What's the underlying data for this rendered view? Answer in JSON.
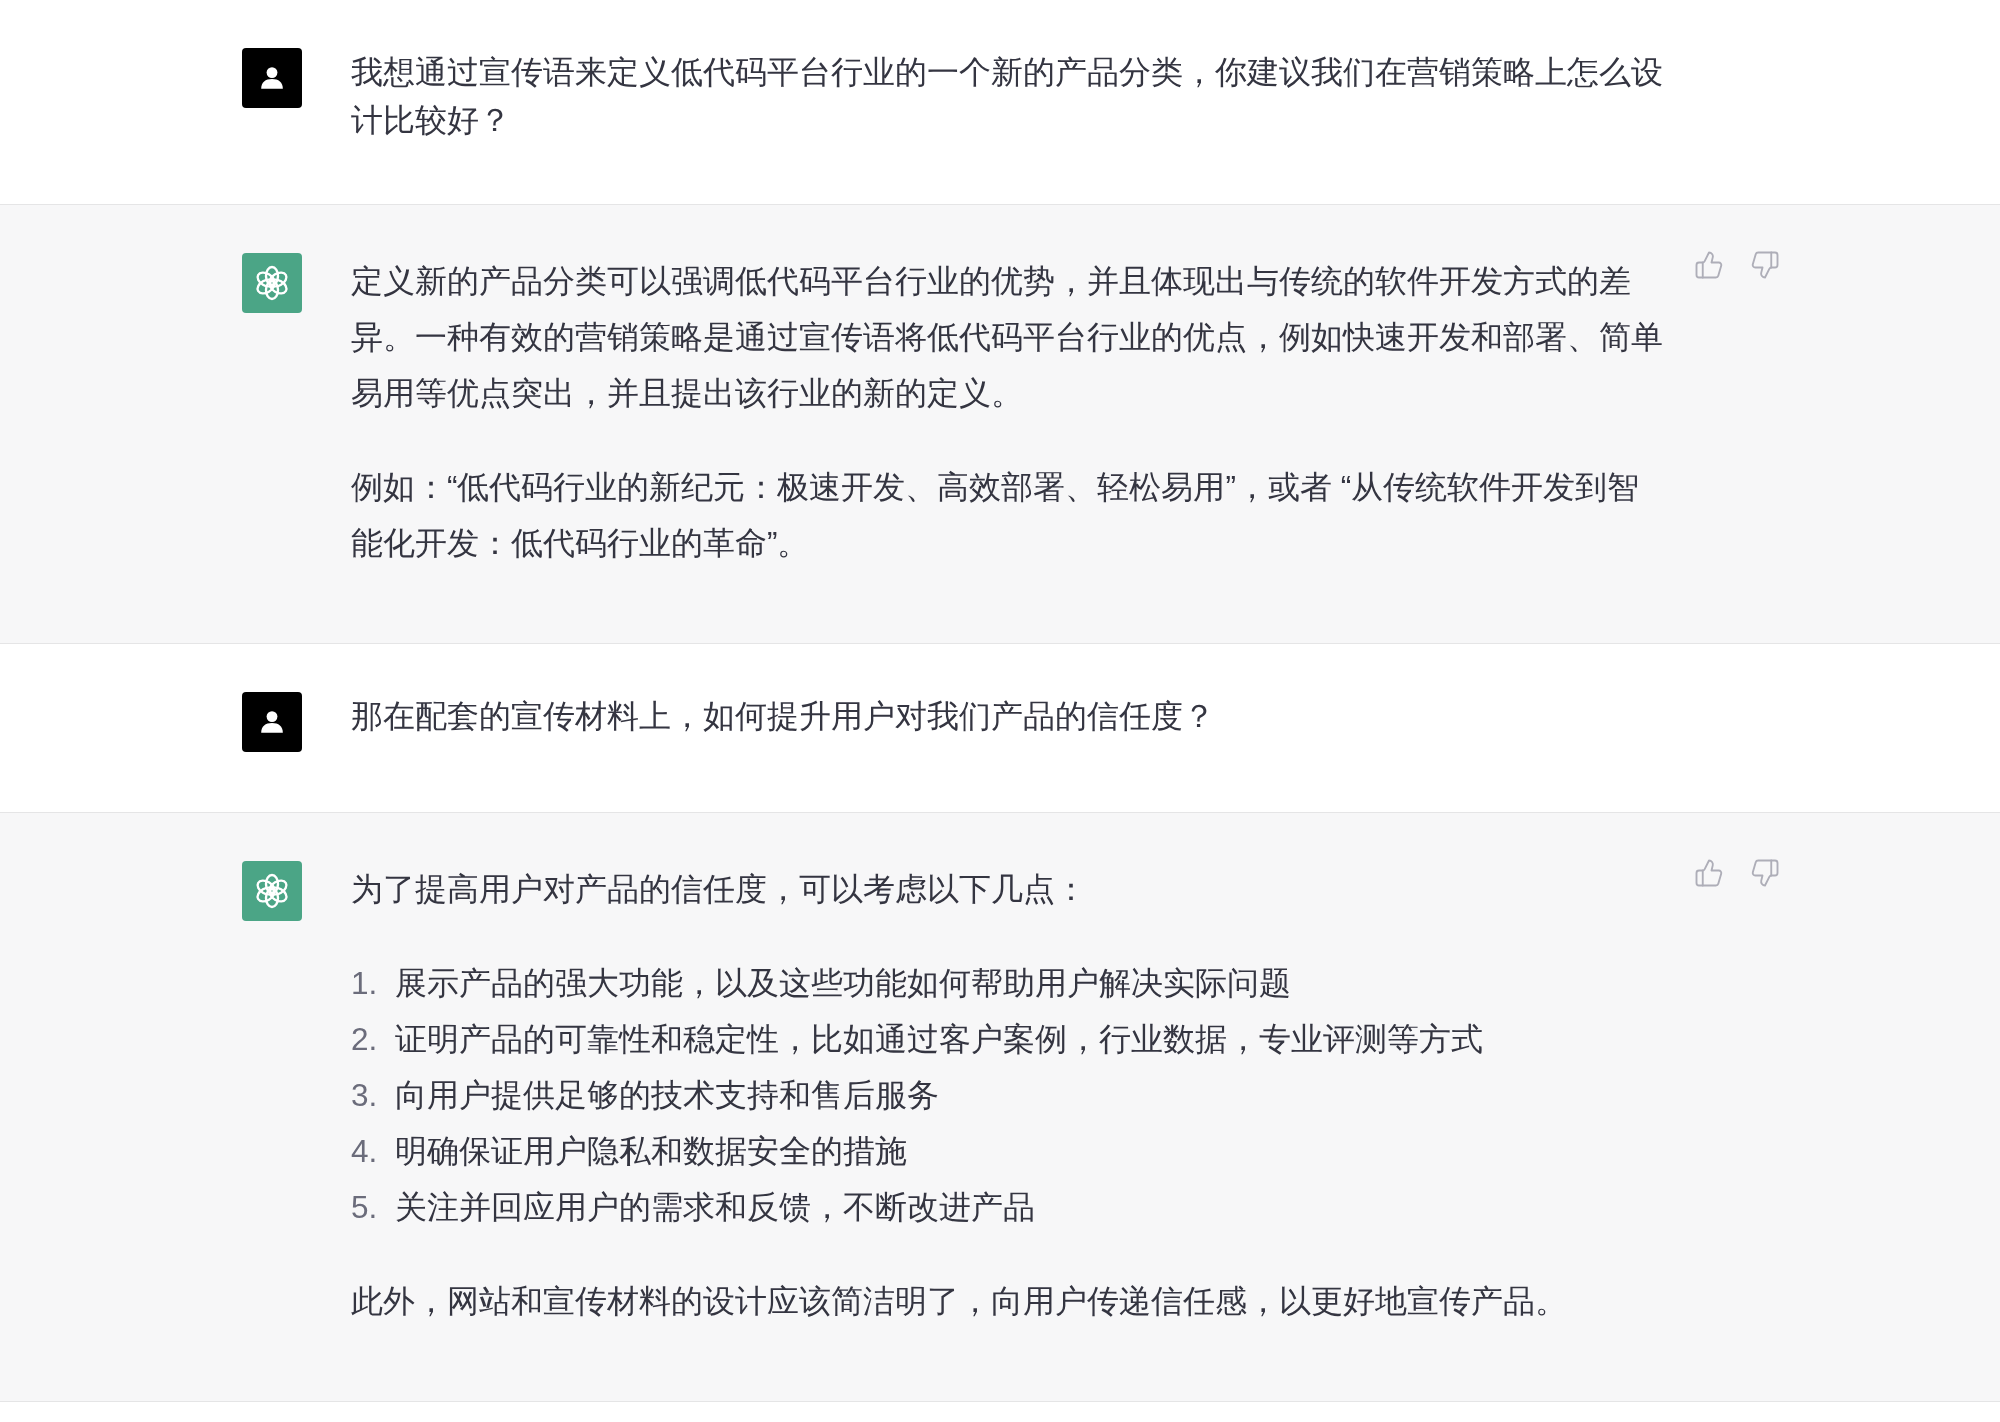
{
  "messages": [
    {
      "kind": "user",
      "blocks": [
        {
          "kind": "paragraph",
          "text": "我想通过宣传语来定义低代码平台行业的一个新的产品分类，你建议我们在营销策略上怎么设计比较好？"
        }
      ]
    },
    {
      "kind": "assistant",
      "blocks": [
        {
          "kind": "paragraph",
          "text": "定义新的产品分类可以强调低代码平台行业的优势，并且体现出与传统的软件开发方式的差异。一种有效的营销策略是通过宣传语将低代码平台行业的优点，例如快速开发和部署、简单易用等优点突出，并且提出该行业的新的定义。"
        },
        {
          "kind": "paragraph",
          "text": "例如：“低代码行业的新纪元：极速开发、高效部署、轻松易用”，或者 “从传统软件开发到智能化开发：低代码行业的革命”。"
        }
      ]
    },
    {
      "kind": "user",
      "blocks": [
        {
          "kind": "paragraph",
          "text": "那在配套的宣传材料上，如何提升用户对我们产品的信任度？"
        }
      ]
    },
    {
      "kind": "assistant",
      "blocks": [
        {
          "kind": "paragraph",
          "text": "为了提高用户对产品的信任度，可以考虑以下几点："
        },
        {
          "kind": "list",
          "items": [
            {
              "number": "1.",
              "text": "展示产品的强大功能，以及这些功能如何帮助用户解决实际问题"
            },
            {
              "number": "2.",
              "text": "证明产品的可靠性和稳定性，比如通过客户案例，行业数据，专业评测等方式"
            },
            {
              "number": "3.",
              "text": "向用户提供足够的技术支持和售后服务"
            },
            {
              "number": "4.",
              "text": "明确保证用户隐私和数据安全的措施"
            },
            {
              "number": "5.",
              "text": "关注并回应用户的需求和反馈，不断改进产品"
            }
          ]
        },
        {
          "kind": "paragraph",
          "text": "此外，网站和宣传材料的设计应该简洁明了，向用户传递信任感，以更好地宣传产品。"
        }
      ]
    }
  ]
}
